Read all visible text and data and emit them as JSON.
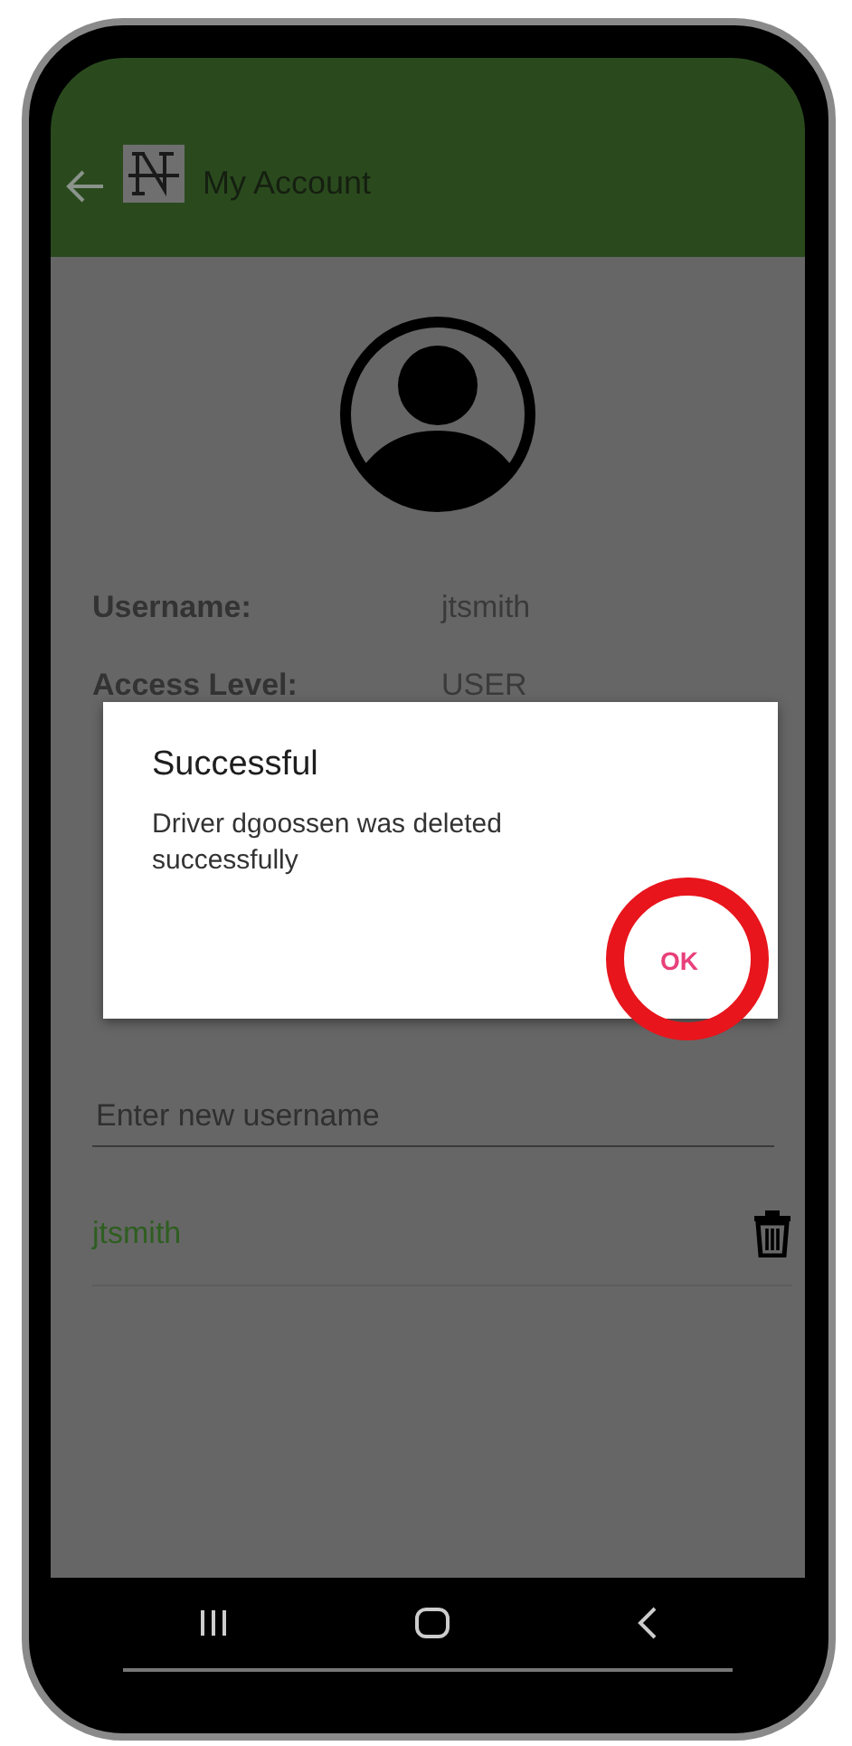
{
  "app_bar": {
    "title": "My Account"
  },
  "profile": {
    "fields": [
      {
        "label": "Username:",
        "value": "jtsmith"
      },
      {
        "label": "Access Level:",
        "value": "USER"
      }
    ]
  },
  "new_user_field": {
    "placeholder": "Enter new username"
  },
  "approved_users": [
    {
      "name": "jtsmith"
    }
  ],
  "dialog": {
    "title": "Successful",
    "message": "Driver dgoossen was deleted successfully",
    "buttons": [
      "OK"
    ]
  }
}
